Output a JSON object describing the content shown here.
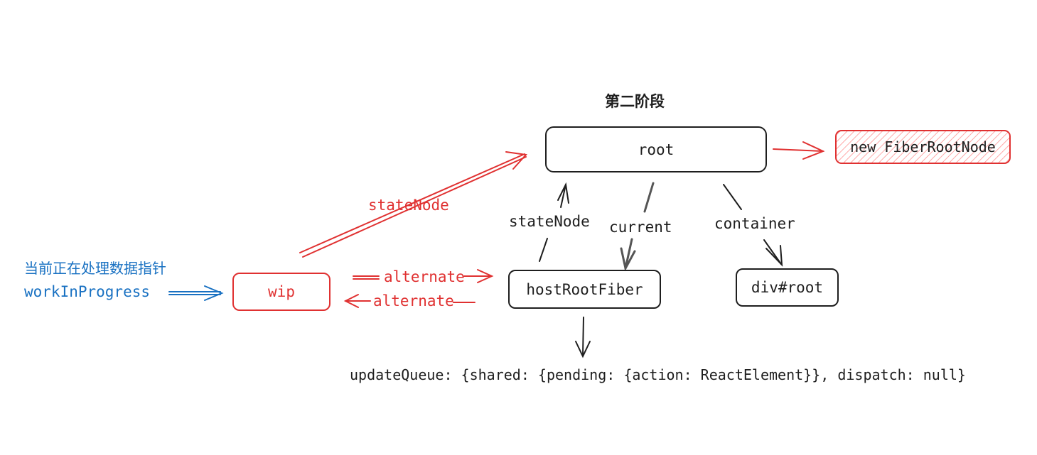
{
  "title": "第二阶段",
  "nodes": {
    "root": "root",
    "fiber_root_node": "new FiberRootNode",
    "wip": "wip",
    "host_root_fiber": "hostRootFiber",
    "div_root": "div#root"
  },
  "edge_labels": {
    "wip_state_node": "stateNode",
    "host_state_node": "stateNode",
    "current": "current",
    "container": "container",
    "alternate_forward": "alternate",
    "alternate_back": "alternate"
  },
  "annotation": {
    "line1": "当前正在处理数据指针",
    "line2": "workInProgress"
  },
  "update_queue": "updateQueue: {shared: {pending: {action: ReactElement}}, dispatch: null}",
  "colors": {
    "ink": "#1e1e1e",
    "red": "#e03131",
    "blue": "#1971c2",
    "hatch_fill": "#ffc9c9"
  }
}
